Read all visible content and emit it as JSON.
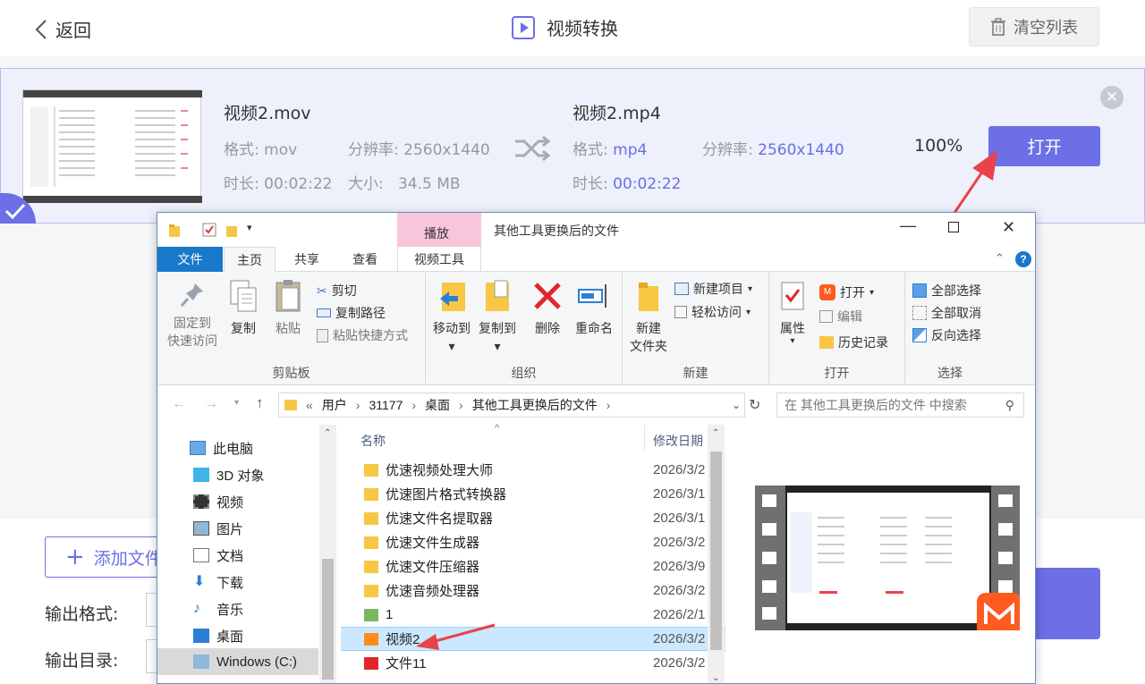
{
  "app": {
    "back_label": "返回",
    "title": "视频转换",
    "clear_label": "清空列表"
  },
  "item": {
    "src_name": "视频2.mov",
    "src_format_label": "格式: ",
    "src_format": "mov",
    "src_res_label": "分辨率: ",
    "src_res": "2560x1440",
    "src_duration_label": "时长: ",
    "src_duration": "00:02:22",
    "src_size_label": "大小:",
    "src_size": "34.5 MB",
    "dst_name": "视频2.mp4",
    "dst_format_label": "格式: ",
    "dst_format": "mp4",
    "dst_res_label": "分辨率: ",
    "dst_res": "2560x1440",
    "dst_duration_label": "时长: ",
    "dst_duration": "00:02:22",
    "progress": "100%",
    "open_label": "打开"
  },
  "bottom": {
    "add_label": "添加文件",
    "output_format_label": "输出格式:",
    "output_dir_label": "输出目录:"
  },
  "explorer": {
    "context_tab": "播放",
    "window_title": "其他工具更换后的文件",
    "tabs": [
      "文件",
      "主页",
      "共享",
      "查看",
      "视频工具"
    ],
    "clipboard": {
      "pin_label": "固定到\n快速访问",
      "copy_label": "复制",
      "paste_label": "粘贴",
      "cut_label": "剪切",
      "copy_path_label": "复制路径",
      "paste_shortcut_label": "粘贴快捷方式",
      "group_label": "剪贴板"
    },
    "organize": {
      "move_label": "移动到",
      "copyto_label": "复制到",
      "delete_label": "删除",
      "rename_label": "重命名",
      "group_label": "组织"
    },
    "new": {
      "folder_label": "新建\n文件夹",
      "item_label": "新建项目",
      "easy_label": "轻松访问",
      "group_label": "新建"
    },
    "open": {
      "props_label": "属性",
      "open_label": "打开",
      "edit_label": "编辑",
      "history_label": "历史记录",
      "group_label": "打开"
    },
    "select": {
      "all_label": "全部选择",
      "none_label": "全部取消",
      "invert_label": "反向选择",
      "group_label": "选择"
    },
    "path": {
      "prefix": "«",
      "parts": [
        "用户",
        "31177",
        "桌面",
        "其他工具更换后的文件"
      ]
    },
    "search_placeholder": "在 其他工具更换后的文件 中搜索",
    "nav_items": [
      "此电脑",
      "3D 对象",
      "视频",
      "图片",
      "文档",
      "下载",
      "音乐",
      "桌面",
      "Windows (C:)"
    ],
    "columns": {
      "name": "名称",
      "date": "修改日期"
    },
    "files": [
      {
        "name": "优速视频处理大师",
        "date": "2026/3/2",
        "kind": "folder"
      },
      {
        "name": "优速图片格式转换器",
        "date": "2026/3/1",
        "kind": "folder"
      },
      {
        "name": "优速文件名提取器",
        "date": "2026/3/1",
        "kind": "folder"
      },
      {
        "name": "优速文件生成器",
        "date": "2026/3/2",
        "kind": "folder"
      },
      {
        "name": "优速文件压缩器",
        "date": "2026/3/9",
        "kind": "folder"
      },
      {
        "name": "优速音频处理器",
        "date": "2026/3/2",
        "kind": "folder"
      },
      {
        "name": "1",
        "date": "2026/2/1",
        "kind": "file"
      },
      {
        "name": "视频2",
        "date": "2026/3/2",
        "kind": "video"
      },
      {
        "name": "文件11",
        "date": "2026/3/2",
        "kind": "doc"
      }
    ]
  },
  "colors": {
    "accent": "#6c6fe6",
    "card_bg": "#eef0fb",
    "selected_row": "#cce8ff",
    "arrow_red": "#e8434a"
  }
}
